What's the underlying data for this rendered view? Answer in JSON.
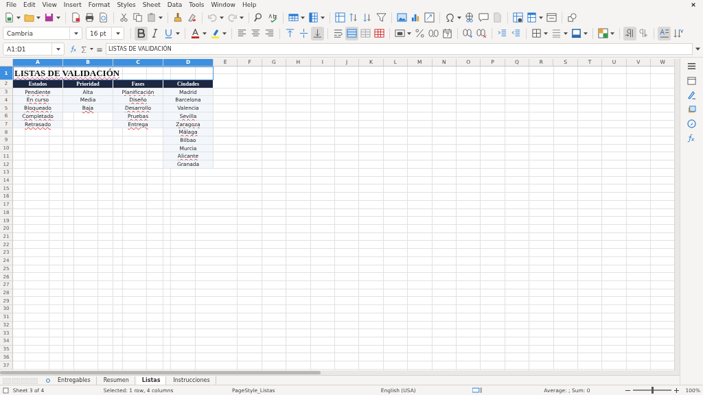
{
  "menu": [
    "File",
    "Edit",
    "View",
    "Insert",
    "Format",
    "Styles",
    "Sheet",
    "Data",
    "Tools",
    "Window",
    "Help"
  ],
  "formatting": {
    "font_name": "Cambria",
    "font_size": "16 pt",
    "bold": true,
    "italic": false,
    "underline": false,
    "align_bottom": true,
    "merge_center": true,
    "left_to_right": true,
    "horizontal_text": true
  },
  "formula_bar": {
    "name_box": "A1:D1",
    "content": "LISTAS DE VALIDACIÓN"
  },
  "columns": [
    {
      "label": "A",
      "selected": true
    },
    {
      "label": "B",
      "selected": true
    },
    {
      "label": "C",
      "selected": true
    },
    {
      "label": "D",
      "selected": true
    },
    {
      "label": "E",
      "selected": false
    },
    {
      "label": "F",
      "selected": false
    },
    {
      "label": "G",
      "selected": false
    },
    {
      "label": "H",
      "selected": false
    },
    {
      "label": "I",
      "selected": false
    },
    {
      "label": "J",
      "selected": false
    },
    {
      "label": "K",
      "selected": false
    },
    {
      "label": "L",
      "selected": false
    },
    {
      "label": "M",
      "selected": false
    },
    {
      "label": "N",
      "selected": false
    },
    {
      "label": "O",
      "selected": false
    },
    {
      "label": "P",
      "selected": false
    },
    {
      "label": "Q",
      "selected": false
    },
    {
      "label": "R",
      "selected": false
    },
    {
      "label": "S",
      "selected": false
    },
    {
      "label": "T",
      "selected": false
    },
    {
      "label": "U",
      "selected": false
    },
    {
      "label": "V",
      "selected": false
    },
    {
      "label": "W",
      "selected": false
    }
  ],
  "rows": [
    {
      "label": "1",
      "selected": true
    },
    {
      "label": "2",
      "selected": false
    },
    {
      "label": "3",
      "selected": false
    },
    {
      "label": "4",
      "selected": false
    },
    {
      "label": "5",
      "selected": false
    },
    {
      "label": "6",
      "selected": false
    },
    {
      "label": "7",
      "selected": false
    },
    {
      "label": "8",
      "selected": false
    },
    {
      "label": "9",
      "selected": false
    },
    {
      "label": "10",
      "selected": false
    },
    {
      "label": "11",
      "selected": false
    },
    {
      "label": "12",
      "selected": false
    },
    {
      "label": "13",
      "selected": false
    },
    {
      "label": "14",
      "selected": false
    },
    {
      "label": "15",
      "selected": false
    },
    {
      "label": "16",
      "selected": false
    },
    {
      "label": "17",
      "selected": false
    },
    {
      "label": "18",
      "selected": false
    },
    {
      "label": "19",
      "selected": false
    },
    {
      "label": "20",
      "selected": false
    },
    {
      "label": "21",
      "selected": false
    },
    {
      "label": "22",
      "selected": false
    },
    {
      "label": "23",
      "selected": false
    },
    {
      "label": "24",
      "selected": false
    },
    {
      "label": "25",
      "selected": false
    },
    {
      "label": "26",
      "selected": false
    },
    {
      "label": "27",
      "selected": false
    },
    {
      "label": "28",
      "selected": false
    },
    {
      "label": "29",
      "selected": false
    },
    {
      "label": "30",
      "selected": false
    },
    {
      "label": "31",
      "selected": false
    },
    {
      "label": "32",
      "selected": false
    },
    {
      "label": "33",
      "selected": false
    },
    {
      "label": "34",
      "selected": false
    },
    {
      "label": "35",
      "selected": false
    },
    {
      "label": "36",
      "selected": false
    },
    {
      "label": "37",
      "selected": false
    }
  ],
  "title": {
    "text": "LISTAS DE VALIDACIÓN",
    "spell_error": true
  },
  "headers": [
    "Estados",
    "Prioridad",
    "Fases",
    "Ciudades"
  ],
  "lists": [
    [
      {
        "text": "Pendiente",
        "spell_error": true
      },
      {
        "text": "En curso",
        "spell_error": true
      },
      {
        "text": "Bloqueado",
        "spell_error": true
      },
      {
        "text": "Completado",
        "spell_error": true
      },
      {
        "text": "Retrasado",
        "spell_error": true
      }
    ],
    [
      {
        "text": "Alta",
        "spell_error": false
      },
      {
        "text": "Media",
        "spell_error": false
      },
      {
        "text": "Baja",
        "spell_error": true
      }
    ],
    [
      {
        "text": "Planificación",
        "spell_error": true
      },
      {
        "text": "Diseño",
        "spell_error": true
      },
      {
        "text": "Desarrollo",
        "spell_error": true
      },
      {
        "text": "Pruebas",
        "spell_error": true
      },
      {
        "text": "Entrega",
        "spell_error": true
      }
    ],
    [
      {
        "text": "Madrid",
        "spell_error": false
      },
      {
        "text": "Barcelona",
        "spell_error": false
      },
      {
        "text": "Valencia",
        "spell_error": false
      },
      {
        "text": "Sevilla",
        "spell_error": true
      },
      {
        "text": "Zaragoza",
        "spell_error": true
      },
      {
        "text": "Málaga",
        "spell_error": true
      },
      {
        "text": "Bilbao",
        "spell_error": false
      },
      {
        "text": "Murcia",
        "spell_error": false
      },
      {
        "text": "Alicante",
        "spell_error": true
      },
      {
        "text": "Granada",
        "spell_error": false
      }
    ]
  ],
  "sheet_tabs": [
    {
      "label": "Entregables",
      "selected": false
    },
    {
      "label": "Resumen",
      "selected": false
    },
    {
      "label": "Listas",
      "selected": true
    },
    {
      "label": "Instrucciones",
      "selected": false
    }
  ],
  "status_bar": {
    "sheet": "Sheet 3 of 4",
    "selection": "Selected: 1 row, 4 columns",
    "page_style": "PageStyle_Listas",
    "language": "English (USA)",
    "sum": "Average: ; Sum: 0",
    "zoom": "100%",
    "zoom_slider": {
      "level": 0.5
    }
  }
}
